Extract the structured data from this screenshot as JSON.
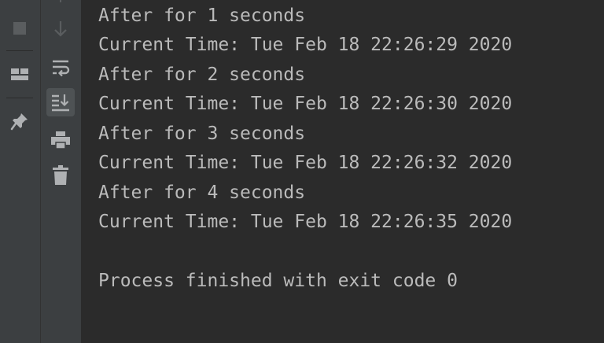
{
  "colors": {
    "sidebar_bg": "#3c3f41",
    "console_bg": "#2b2b2b",
    "text": "#bbbbbb",
    "icon": "#afb1b3",
    "icon_disabled": "#5a5d5f",
    "active_bg": "#4e5254"
  },
  "toolbar": {
    "icons": [
      "stop-icon",
      "layout-icon",
      "pin-icon",
      "down-arrow-icon",
      "soft-wrap-icon",
      "scroll-to-end-icon",
      "print-icon",
      "trash-icon"
    ]
  },
  "console": {
    "lines": [
      "After for 1 seconds",
      "Current Time: Tue Feb 18 22:26:29 2020",
      "After for 2 seconds",
      "Current Time: Tue Feb 18 22:26:30 2020",
      "After for 3 seconds",
      "Current Time: Tue Feb 18 22:26:32 2020",
      "After for 4 seconds",
      "Current Time: Tue Feb 18 22:26:35 2020",
      "",
      "Process finished with exit code 0"
    ]
  }
}
